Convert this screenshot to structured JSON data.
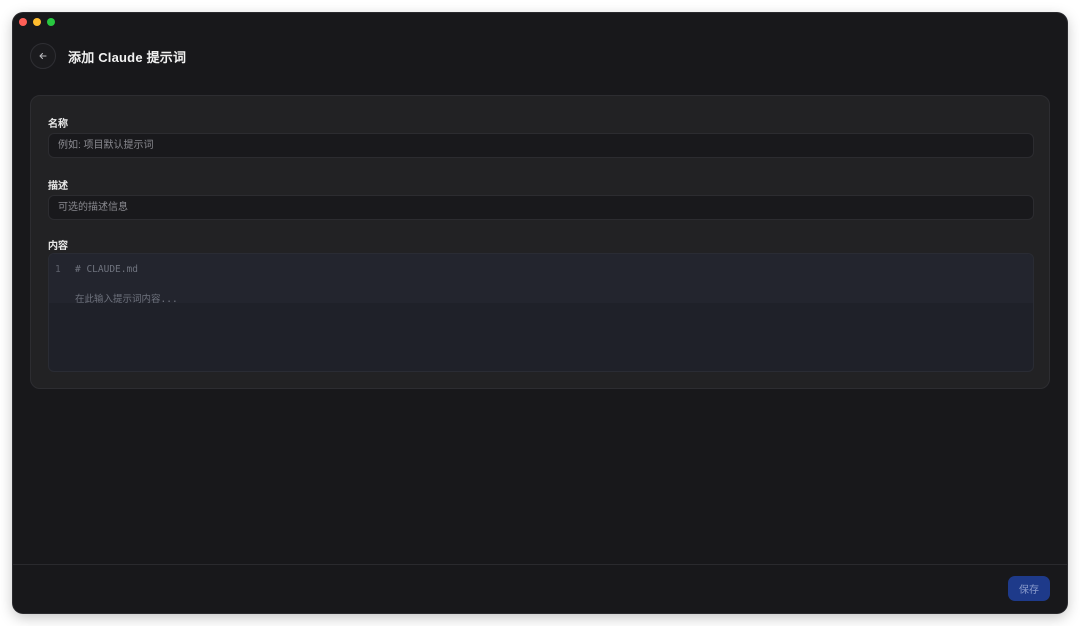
{
  "window": {
    "traffic_lights": [
      "close",
      "minimize",
      "maximize"
    ]
  },
  "header": {
    "back_icon": "arrow-left-icon",
    "title": "添加 Claude 提示词"
  },
  "form": {
    "name": {
      "label": "名称",
      "value": "",
      "placeholder": "例如: 项目默认提示词"
    },
    "description": {
      "label": "描述",
      "value": "",
      "placeholder": "可选的描述信息"
    },
    "content": {
      "label": "内容",
      "line_number": "1",
      "first_line": "# CLAUDE.md",
      "placeholder_line": "在此输入提示词内容..."
    }
  },
  "footer": {
    "save_label": "保存"
  },
  "colors": {
    "background": "#18181b",
    "card": "#222224",
    "accent": "#1e3a8a"
  }
}
